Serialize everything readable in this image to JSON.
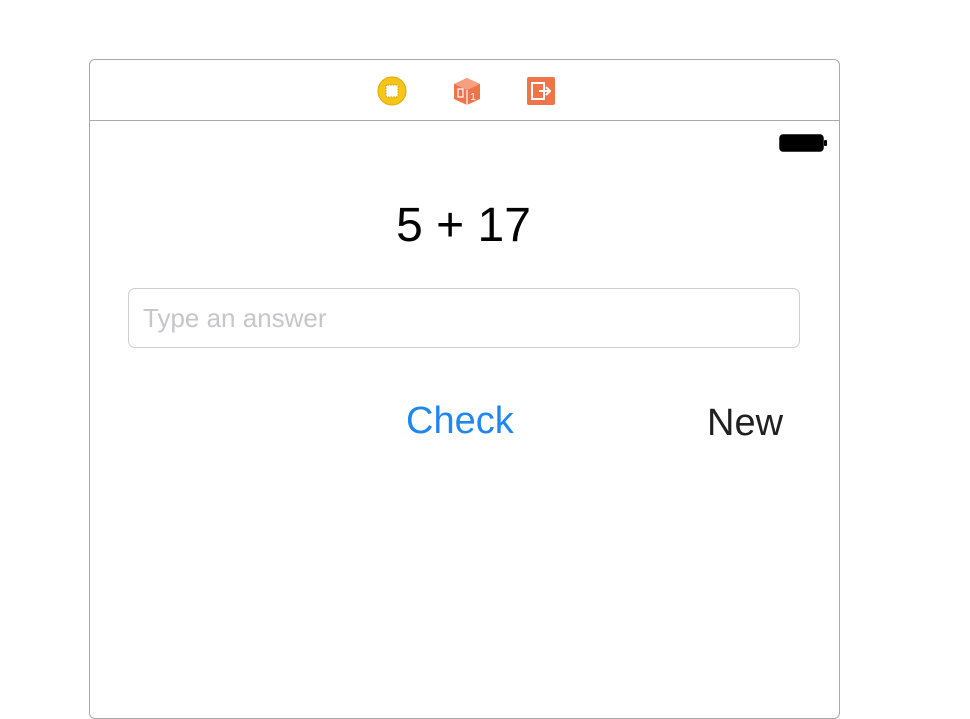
{
  "scene_dock": {
    "icons": [
      {
        "name": "view-controller-icon",
        "color": "#f5c518"
      },
      {
        "name": "first-responder-icon",
        "color": "#f0744a"
      },
      {
        "name": "exit-icon",
        "color": "#f0744a"
      }
    ]
  },
  "status_bar": {
    "battery_icon": "battery-full-icon"
  },
  "main": {
    "equation": "5 + 17",
    "answer_placeholder": "Type an answer",
    "answer_value": "",
    "check_label": "Check",
    "new_label": "New"
  },
  "colors": {
    "accent": "#1e88f0",
    "frame_border": "#a9a9a9",
    "placeholder": "#c6c6cb"
  }
}
